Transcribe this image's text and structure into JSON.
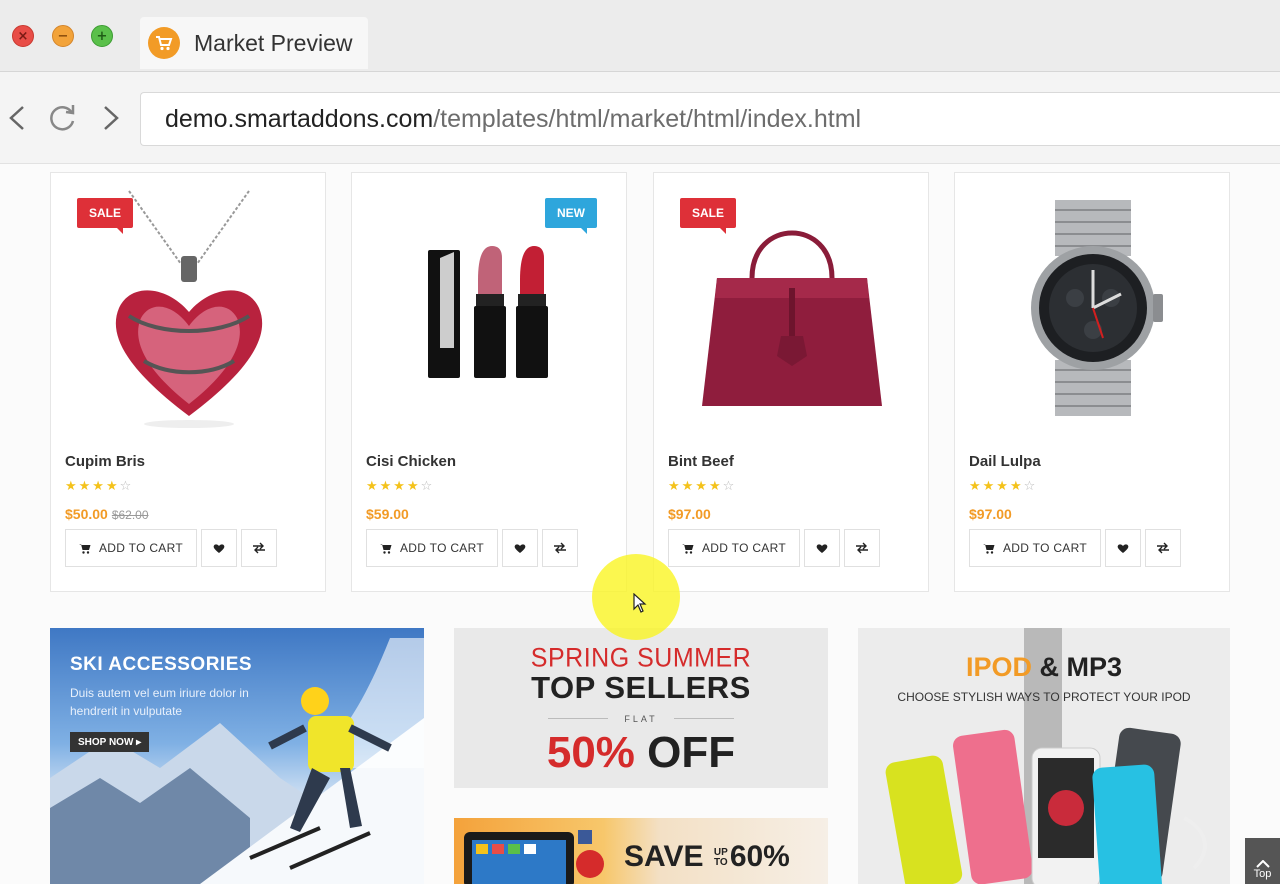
{
  "window": {
    "tab_title": "Market Preview",
    "tab_icon": "shopping-cart-icon",
    "close_glyph": "×",
    "minimize_glyph": "−",
    "maximize_glyph": "+"
  },
  "address_bar": {
    "domain": "demo.smartaddons.com",
    "path": "/templates/html/market/html/index.html"
  },
  "products": [
    {
      "name": "Cupim Bris",
      "badge": "SALE",
      "rating": 4,
      "stars": "★★★★",
      "star_empty": "☆",
      "price": "$50.00",
      "old_price": "$62.00",
      "cart_label": "ADD TO CART"
    },
    {
      "name": "Cisi Chicken",
      "badge": "NEW",
      "rating": 4,
      "stars": "★★★★",
      "star_empty": "☆",
      "price": "$59.00",
      "old_price": "",
      "cart_label": "ADD TO CART"
    },
    {
      "name": "Bint Beef",
      "badge": "SALE",
      "rating": 4,
      "stars": "★★★★",
      "star_empty": "☆",
      "price": "$97.00",
      "old_price": "",
      "cart_label": "ADD TO CART"
    },
    {
      "name": "Dail Lulpa",
      "badge": "",
      "rating": 4,
      "stars": "★★★★",
      "star_empty": "☆",
      "price": "$97.00",
      "old_price": "",
      "cart_label": "ADD TO CART"
    }
  ],
  "banners": {
    "ski": {
      "title": "SKI ACCESSORIES",
      "text": "Duis autem vel eum iriure dolor in hendrerit in vulputate",
      "button": "SHOP NOW ▸"
    },
    "spring": {
      "line1": "SPRING SUMMER",
      "line2": "TOP SELLERS",
      "flat": "FLAT",
      "percent": "50%",
      "off": "OFF"
    },
    "save": {
      "save": "SAVE",
      "upto": "UP TO",
      "percent": "60%"
    },
    "ipod": {
      "title_hl": "IPOD",
      "title_rest": " & MP3",
      "subtitle": "CHOOSE STYLISH WAYS TO PROTECT YOUR IPOD"
    }
  },
  "back_to_top": "Top",
  "colors": {
    "accent": "#f29b26",
    "sale": "#de3038",
    "new": "#2ea6dc",
    "star": "#f4c21b"
  }
}
